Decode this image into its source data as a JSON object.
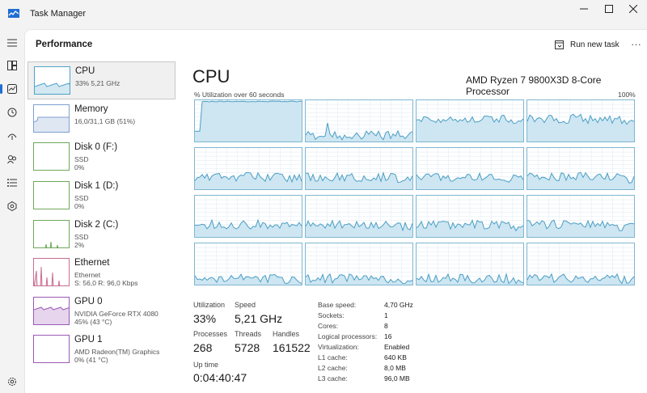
{
  "window": {
    "title": "Task Manager"
  },
  "header": {
    "title": "Performance",
    "run_task_label": "Run new task",
    "more_label": "..."
  },
  "nav": [
    "hamburger-icon",
    "processes-icon",
    "performance-icon",
    "app-history-icon",
    "startup-icon",
    "users-icon",
    "details-icon",
    "services-icon",
    "settings-icon"
  ],
  "devices": [
    {
      "name": "CPU",
      "sub1": "33% 5,21 GHz",
      "sub2": "",
      "sub3": "",
      "color": "#4ea3c8"
    },
    {
      "name": "Memory",
      "sub1": "16,0/31,1 GB (51%)",
      "sub2": "",
      "sub3": "",
      "color": "#7f9fd0"
    },
    {
      "name": "Disk 0 (F:)",
      "sub1": "SSD",
      "sub2": "0%",
      "sub3": "",
      "color": "#6fa85a"
    },
    {
      "name": "Disk 1 (D:)",
      "sub1": "SSD",
      "sub2": "0%",
      "sub3": "",
      "color": "#6fa85a"
    },
    {
      "name": "Disk 2 (C:)",
      "sub1": "SSD",
      "sub2": "2%",
      "sub3": "",
      "color": "#6fa85a"
    },
    {
      "name": "Ethernet",
      "sub1": "Ethernet",
      "sub2": "S: 56,0 R: 96,0 Kbps",
      "sub3": "",
      "color": "#c86d8f"
    },
    {
      "name": "GPU 0",
      "sub1": "NVIDIA GeForce RTX 4080",
      "sub2": "45% (43 °C)",
      "sub3": "",
      "color": "#9b59b6"
    },
    {
      "name": "GPU 1",
      "sub1": "AMD Radeon(TM) Graphics",
      "sub2": "0% (41 °C)",
      "sub3": "",
      "color": "#9b59b6"
    }
  ],
  "cpu": {
    "title": "CPU",
    "model": "AMD Ryzen 7 9800X3D 8-Core Processor",
    "util_label": "% Utilization over 60 seconds",
    "util_max": "100%",
    "stats": {
      "utilization_label": "Utilization",
      "utilization": "33%",
      "speed_label": "Speed",
      "speed": "5,21 GHz",
      "processes_label": "Processes",
      "processes": "268",
      "threads_label": "Threads",
      "threads": "5728",
      "handles_label": "Handles",
      "handles": "161522",
      "uptime_label": "Up time",
      "uptime": "0:04:40:47"
    },
    "specs": [
      {
        "label": "Base speed:",
        "value": "4,70 GHz"
      },
      {
        "label": "Sockets:",
        "value": "1"
      },
      {
        "label": "Cores:",
        "value": "8"
      },
      {
        "label": "Logical processors:",
        "value": "16"
      },
      {
        "label": "Virtualization:",
        "value": "Enabled"
      },
      {
        "label": "L1 cache:",
        "value": "640 KB"
      },
      {
        "label": "L2 cache:",
        "value": "8,0 MB"
      },
      {
        "label": "L3 cache:",
        "value": "96,0 MB"
      }
    ]
  },
  "colors": {
    "accent": "#1f6ed4",
    "graph_line": "#4b9ec4",
    "graph_fill": "#cde6f2",
    "graph_border": "#7eb6d0"
  }
}
